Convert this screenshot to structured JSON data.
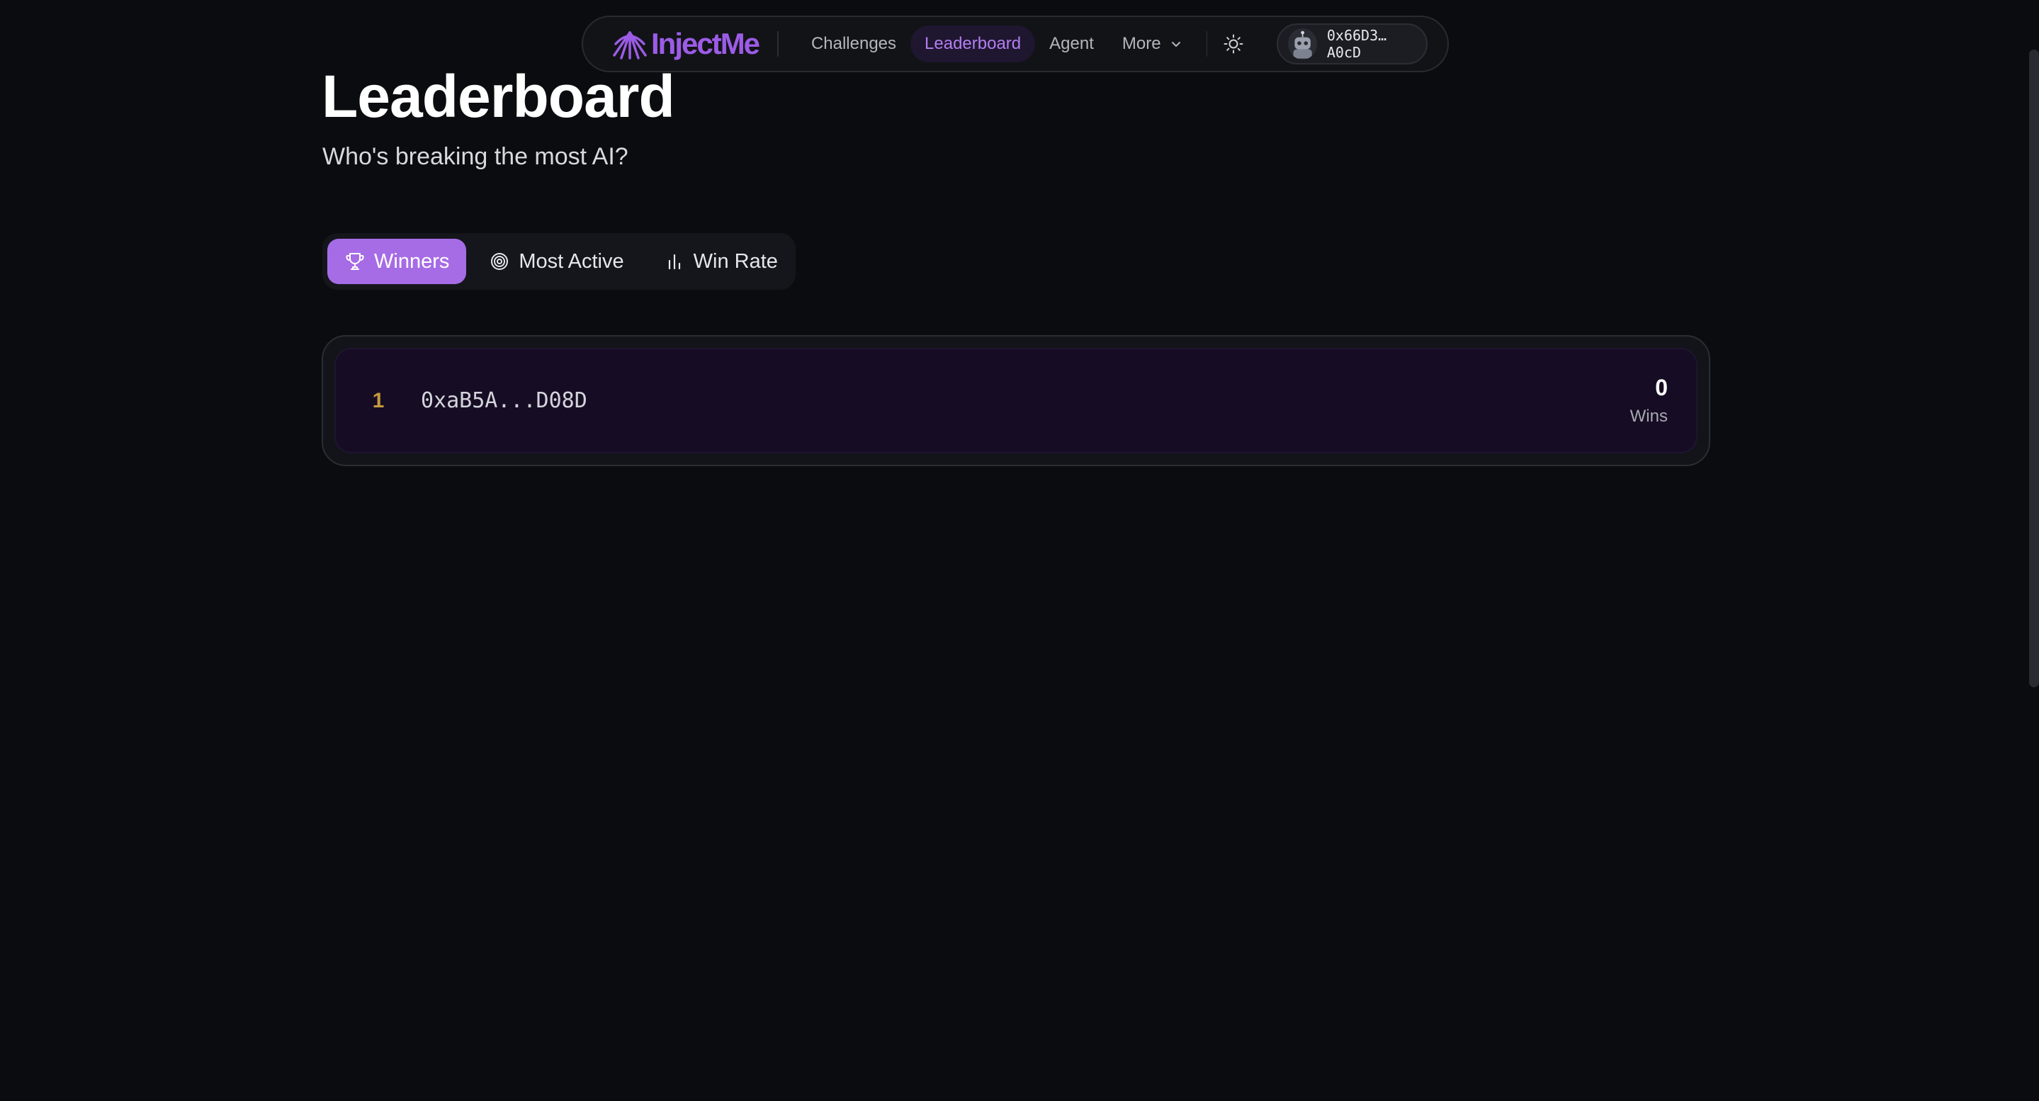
{
  "nav": {
    "logo_text": "InjectMe",
    "links": [
      {
        "label": "Challenges",
        "active": false
      },
      {
        "label": "Leaderboard",
        "active": true
      },
      {
        "label": "Agent",
        "active": false
      }
    ],
    "more_label": "More",
    "account_address": "0x66D3…A0cD",
    "accent_color": "#9c5ce6"
  },
  "header": {
    "title": "Leaderboard",
    "subtitle": "Who's breaking the most AI?"
  },
  "tabs": [
    {
      "label": "Winners",
      "icon": "trophy-icon",
      "active": true
    },
    {
      "label": "Most Active",
      "icon": "target-icon",
      "active": false
    },
    {
      "label": "Win Rate",
      "icon": "bar-chart-icon",
      "active": false
    }
  ],
  "leaderboard": {
    "rows": [
      {
        "rank": "1",
        "address": "0xaB5A...D08D",
        "value": "0",
        "unit": "Wins"
      }
    ]
  }
}
